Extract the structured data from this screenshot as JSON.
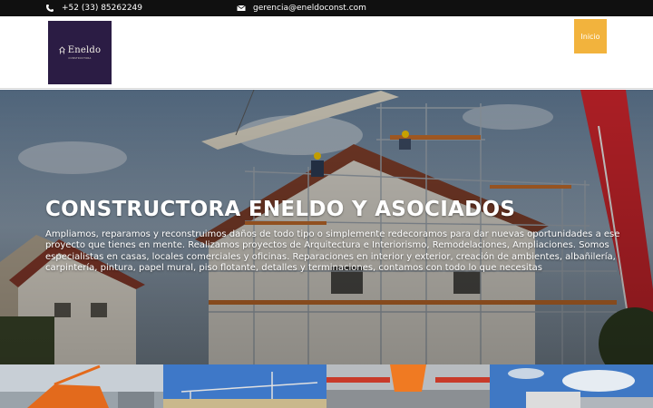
{
  "topbar": {
    "phone": "+52 (33) 85262249",
    "email": "gerencia@eneldoconst.com",
    "phone_icon": "phone-icon",
    "email_icon": "envelope-icon"
  },
  "header": {
    "logo": {
      "brand": "Eneldo",
      "tagline": "CONSTRUCTORA"
    },
    "nav": {
      "home_label": "Inicio"
    }
  },
  "hero": {
    "title": "CONSTRUCTORA ENELDO Y ASOCIADOS",
    "description": "Ampliamos, reparamos y reconstruimos daños de todo tipo o simplemente redecoramos para dar nuevas oportunidades a ese proyecto que tienes en mente. Realizamos proyectos de Arquitectura e Interiorismo, Remodelaciones, Ampliaciones. Somos especialistas en casas, locales comerciales y oficinas. Reparaciones en interior y exterior, creación de ambientes, albañilería, carpintería, pintura, papel mural, piso flotante, detalles y terminaciones, contamos con todo lo que necesitas"
  },
  "colors": {
    "topbar_bg": "#101010",
    "logo_bg": "#2b1c44",
    "accent": "#f2b33d"
  }
}
